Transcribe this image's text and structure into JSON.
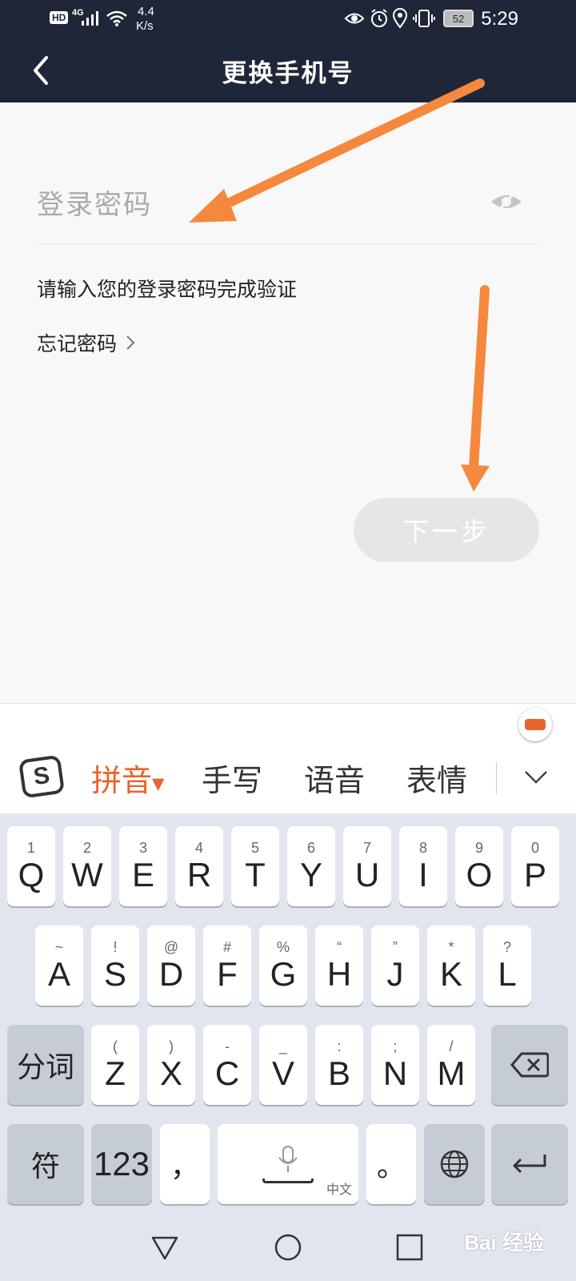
{
  "status_bar": {
    "hd": "HD",
    "signal": "4G",
    "speed_value": "4.4",
    "speed_unit": "K/s",
    "battery": "52",
    "time": "5:29"
  },
  "header": {
    "title": "更换手机号"
  },
  "form": {
    "password_placeholder": "登录密码",
    "hint": "请输入您的登录密码完成验证",
    "forgot_label": "忘记密码",
    "next_label": "下一步"
  },
  "keyboard": {
    "tabs": [
      "拼音",
      "手写",
      "语音",
      "表情"
    ],
    "active_tab": "拼音",
    "active_color": "#e8642c",
    "row1": [
      {
        "main": "Q",
        "sub": "1"
      },
      {
        "main": "W",
        "sub": "2"
      },
      {
        "main": "E",
        "sub": "3"
      },
      {
        "main": "R",
        "sub": "4"
      },
      {
        "main": "T",
        "sub": "5"
      },
      {
        "main": "Y",
        "sub": "6"
      },
      {
        "main": "U",
        "sub": "7"
      },
      {
        "main": "I",
        "sub": "8"
      },
      {
        "main": "O",
        "sub": "9"
      },
      {
        "main": "P",
        "sub": "0"
      }
    ],
    "row2": [
      {
        "main": "A",
        "sub": "~"
      },
      {
        "main": "S",
        "sub": "!"
      },
      {
        "main": "D",
        "sub": "@"
      },
      {
        "main": "F",
        "sub": "#"
      },
      {
        "main": "G",
        "sub": "%"
      },
      {
        "main": "H",
        "sub": "“"
      },
      {
        "main": "J",
        "sub": "”"
      },
      {
        "main": "K",
        "sub": "*"
      },
      {
        "main": "L",
        "sub": "?"
      }
    ],
    "row3": [
      {
        "main": "Z",
        "sub": "("
      },
      {
        "main": "X",
        "sub": ")"
      },
      {
        "main": "C",
        "sub": "-"
      },
      {
        "main": "V",
        "sub": "_"
      },
      {
        "main": "B",
        "sub": ":"
      },
      {
        "main": "N",
        "sub": ";"
      },
      {
        "main": "M",
        "sub": "/"
      }
    ],
    "segment_label": "分词",
    "symbol_label": "符",
    "num_label": "123",
    "comma": "，",
    "space_lang": "中文",
    "period": "。"
  },
  "watermark": "Bai 经验",
  "colors": {
    "header_bg": "#1f2638",
    "arrow": "#f5883c",
    "keyboard_bg": "#e1e6ee"
  }
}
